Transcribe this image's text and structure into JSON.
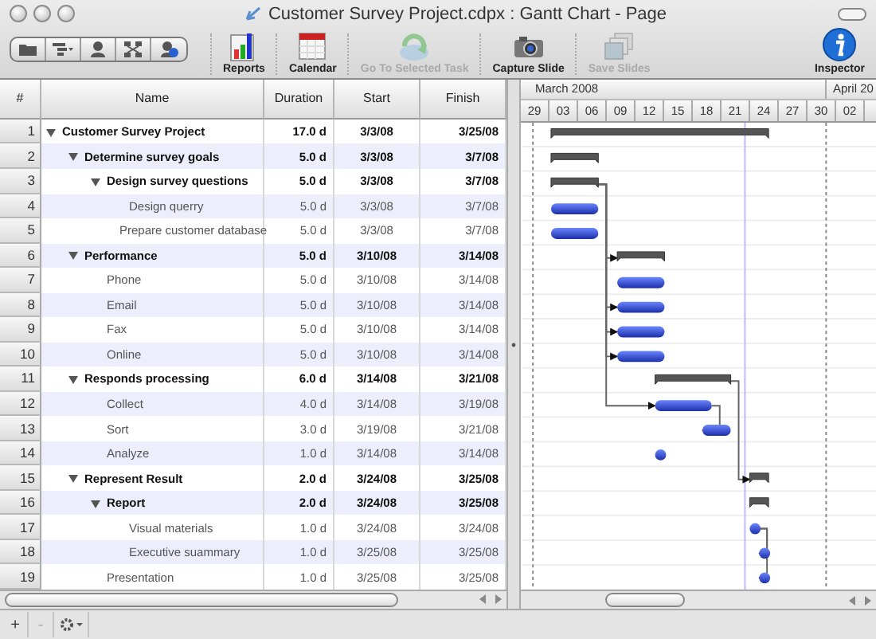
{
  "window": {
    "title": "Customer Survey Project.cdpx : Gantt Chart - Page"
  },
  "toolbar": {
    "view_buttons": [
      {
        "kind": "folder"
      },
      {
        "kind": "outline"
      },
      {
        "kind": "person"
      },
      {
        "kind": "network"
      },
      {
        "kind": "resource"
      }
    ],
    "items": [
      {
        "label": "Reports",
        "kind": "reports",
        "disabled": false
      },
      {
        "label": "Calendar",
        "kind": "calendar",
        "disabled": false
      },
      {
        "label": "Go To Selected Task",
        "kind": "goto",
        "disabled": true
      },
      {
        "label": "Capture Slide",
        "kind": "camera",
        "disabled": false
      },
      {
        "label": "Save Slides",
        "kind": "slides",
        "disabled": true
      },
      {
        "label": "Inspector",
        "kind": "inspector",
        "disabled": false
      }
    ]
  },
  "table": {
    "columns": [
      "#",
      "Name",
      "Duration",
      "Start",
      "Finish"
    ],
    "rows": [
      {
        "number": "1",
        "name": "Customer Survey Project",
        "duration": "17.0 d",
        "start": "3/3/08",
        "finish": "3/25/08",
        "kind": "summary",
        "expanded": true,
        "children": [
          {
            "number": "2",
            "name": "Determine survey goals",
            "duration": "5.0 d",
            "start": "3/3/08",
            "finish": "3/7/08",
            "kind": "summary",
            "expanded": true,
            "children": [
              {
                "number": "3",
                "name": "Design survey questions",
                "duration": "5.0 d",
                "start": "3/3/08",
                "finish": "3/7/08",
                "kind": "summary",
                "expanded": true,
                "children": [
                  {
                    "number": "4",
                    "name": "Design querry",
                    "duration": "5.0 d",
                    "start": "3/3/08",
                    "finish": "3/7/08",
                    "kind": "task"
                  },
                  {
                    "number": "5",
                    "name": "Prepare customer database",
                    "duration": "5.0 d",
                    "start": "3/3/08",
                    "finish": "3/7/08",
                    "kind": "task"
                  }
                ]
              }
            ]
          },
          {
            "number": "6",
            "name": "Performance",
            "duration": "5.0 d",
            "start": "3/10/08",
            "finish": "3/14/08",
            "kind": "summary",
            "expanded": true,
            "children": [
              {
                "number": "7",
                "name": "Phone",
                "duration": "5.0 d",
                "start": "3/10/08",
                "finish": "3/14/08",
                "kind": "task"
              },
              {
                "number": "8",
                "name": "Email",
                "duration": "5.0 d",
                "start": "3/10/08",
                "finish": "3/14/08",
                "kind": "task"
              },
              {
                "number": "9",
                "name": "Fax",
                "duration": "5.0 d",
                "start": "3/10/08",
                "finish": "3/14/08",
                "kind": "task"
              },
              {
                "number": "10",
                "name": "Online",
                "duration": "5.0 d",
                "start": "3/10/08",
                "finish": "3/14/08",
                "kind": "task"
              }
            ]
          },
          {
            "number": "11",
            "name": "Responds processing",
            "duration": "6.0 d",
            "start": "3/14/08",
            "finish": "3/21/08",
            "kind": "summary",
            "expanded": true,
            "children": [
              {
                "number": "12",
                "name": "Collect",
                "duration": "4.0 d",
                "start": "3/14/08",
                "finish": "3/19/08",
                "kind": "task"
              },
              {
                "number": "13",
                "name": "Sort",
                "duration": "3.0 d",
                "start": "3/19/08",
                "finish": "3/21/08",
                "kind": "task"
              },
              {
                "number": "14",
                "name": "Analyze",
                "duration": "1.0 d",
                "start": "3/14/08",
                "finish": "3/14/08",
                "kind": "point"
              }
            ]
          },
          {
            "number": "15",
            "name": "Represent Result",
            "duration": "2.0 d",
            "start": "3/24/08",
            "finish": "3/25/08",
            "kind": "summary",
            "expanded": true,
            "children": [
              {
                "number": "16",
                "name": "Report",
                "duration": "2.0 d",
                "start": "3/24/08",
                "finish": "3/25/08",
                "kind": "summary",
                "expanded": true,
                "children": [
                  {
                    "number": "17",
                    "name": "Visual materials",
                    "duration": "1.0 d",
                    "start": "3/24/08",
                    "finish": "3/24/08",
                    "kind": "point"
                  },
                  {
                    "number": "18",
                    "name": "Executive suammary",
                    "duration": "1.0 d",
                    "start": "3/25/08",
                    "finish": "3/25/08",
                    "kind": "point"
                  }
                ]
              },
              {
                "number": "19",
                "name": "Presentation",
                "duration": "1.0 d",
                "start": "3/25/08",
                "finish": "3/25/08",
                "kind": "point"
              }
            ]
          }
        ]
      }
    ]
  },
  "timeline": {
    "months": [
      "March 2008",
      "April 20"
    ],
    "days": [
      "29",
      "03",
      "06",
      "09",
      "12",
      "15",
      "18",
      "21",
      "24",
      "27",
      "30",
      "02"
    ]
  },
  "bottom_bar": {
    "buttons": [
      {
        "label": "+",
        "disabled": false
      },
      {
        "label": "-",
        "disabled": true
      }
    ]
  }
}
